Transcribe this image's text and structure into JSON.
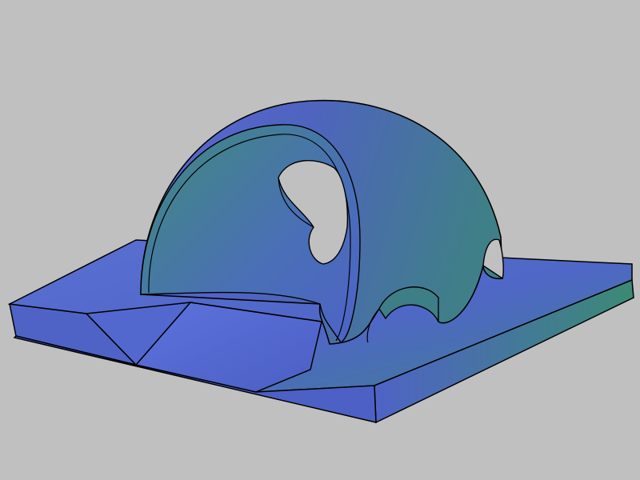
{
  "viewport": {
    "background": "#c0c0c0"
  },
  "model": {
    "kind": "3d-cad-part",
    "colors": {
      "base_top": "#5065c8",
      "base_edge": "#3c7f86",
      "arch_outer": "#4f62c4",
      "arch_inner": "#3d8a77",
      "outline": "#000000"
    }
  }
}
